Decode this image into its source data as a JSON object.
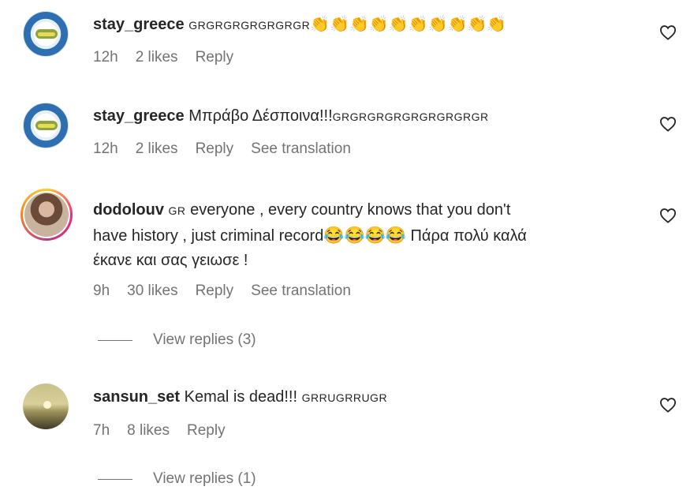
{
  "comments": [
    {
      "username": "stay_greece",
      "text_main": "",
      "text_tail": "GRGRGRGRGRGRGR",
      "emoji": "👏👏👏👏👏👏👏👏👏👏",
      "time": "12h",
      "likes": "2 likes",
      "reply": "Reply",
      "translation": ""
    },
    {
      "username": "stay_greece",
      "text_main": "Μπράβο Δέσποινα!!!",
      "text_tail": "GRGRGRGRGRGRGRGRGR",
      "time": "12h",
      "likes": "2 likes",
      "reply": "Reply",
      "translation": "See translation"
    },
    {
      "username": "dodolouv",
      "line1_prefix": "GR",
      "line1": "everyone , every country knows that you don't",
      "line2": "have history , just criminal record",
      "laugh": "😂😂😂😂",
      "line2_tail": "Πάρα πολύ καλά",
      "line3": "έκανε και σας γειωσε !",
      "time": "9h",
      "likes": "30 likes",
      "reply": "Reply",
      "translation": "See translation",
      "view_replies": "View replies (3)"
    },
    {
      "username": "sansun_set",
      "text_main": "Kemal is dead!!!",
      "text_tail": "GRRUGRRUGR",
      "time": "7h",
      "likes": "8 likes",
      "reply": "Reply",
      "view_replies": "View replies (1)"
    }
  ]
}
